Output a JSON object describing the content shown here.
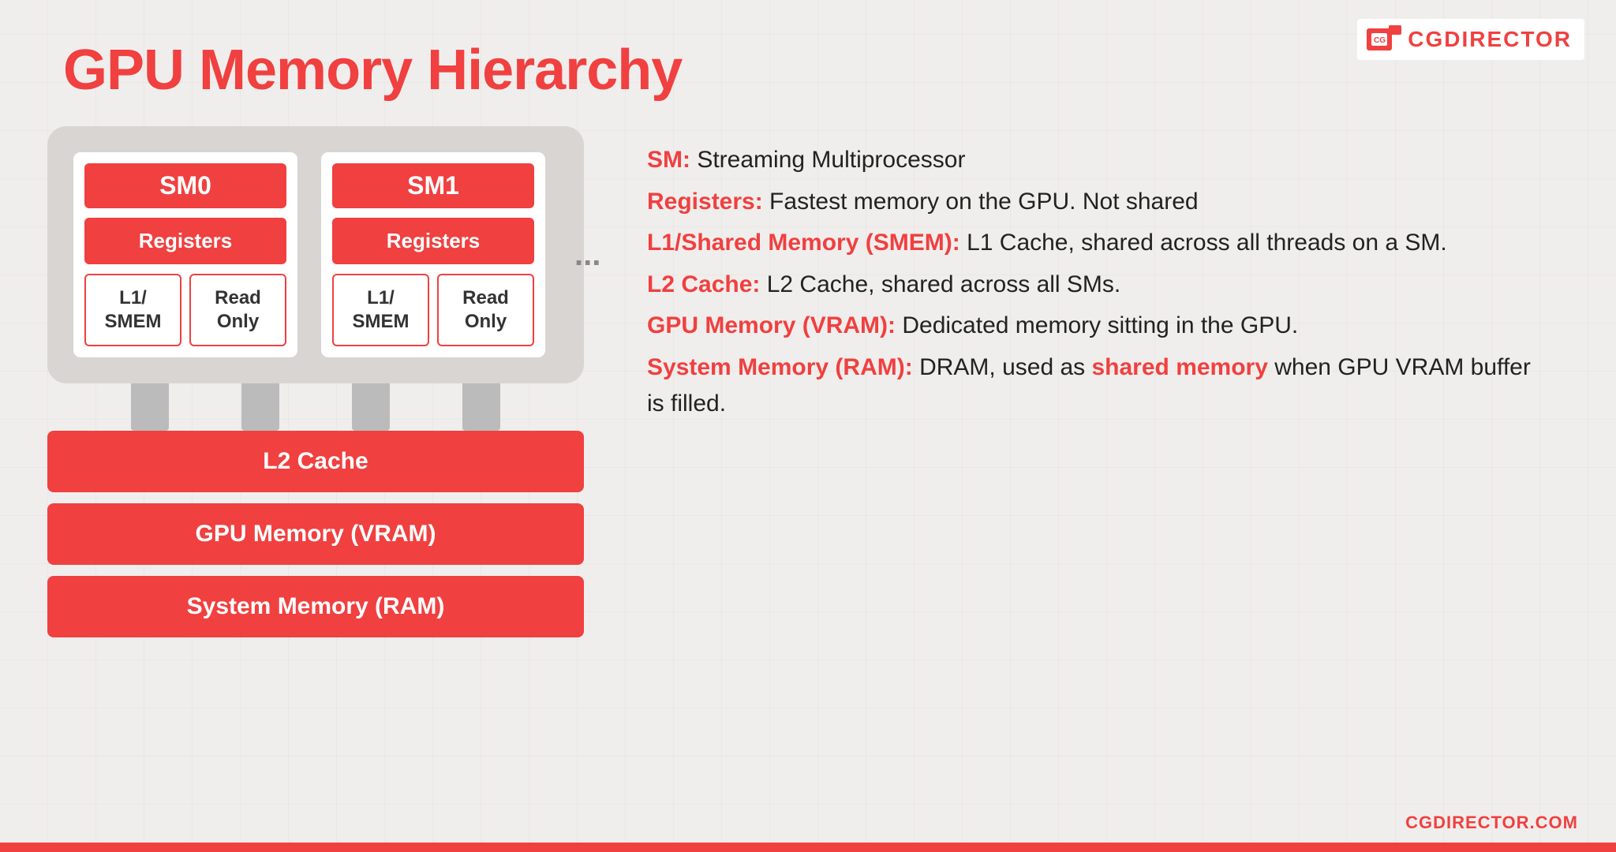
{
  "title": "GPU Memory Hierarchy",
  "logo": {
    "text_cg": "CG",
    "text_director": "DIRECTOR",
    "url": "CGDIRECTOR.COM"
  },
  "diagram": {
    "sm0": {
      "title": "SM0",
      "registers": "Registers",
      "l1smem": "L1/\nSMEM",
      "readonly": "Read\nOnly"
    },
    "sm1": {
      "title": "SM1",
      "registers": "Registers",
      "l1smem": "L1/\nSMEM",
      "readonly": "Read\nOnly"
    },
    "ellipsis": "...",
    "bars": [
      "L2 Cache",
      "GPU Memory (VRAM)",
      "System Memory (RAM)"
    ]
  },
  "descriptions": [
    {
      "bold": "SM:",
      "text": " Streaming Multiprocessor"
    },
    {
      "bold": "Registers:",
      "text": " Fastest memory on the GPU. Not shared"
    },
    {
      "bold": "L1/Shared Memory (SMEM):",
      "text": " L1 Cache, shared across all threads on a SM."
    },
    {
      "bold": "L2 Cache:",
      "text": " L2 Cache, shared across all SMs."
    },
    {
      "bold": "GPU Memory (VRAM):",
      "text": " Dedicated memory sitting in the GPU."
    },
    {
      "bold": "System Memory (RAM):",
      "text": " DRAM, used as ",
      "bold2": "shared memory",
      "text2": " when GPU VRAM buffer is filled."
    }
  ]
}
